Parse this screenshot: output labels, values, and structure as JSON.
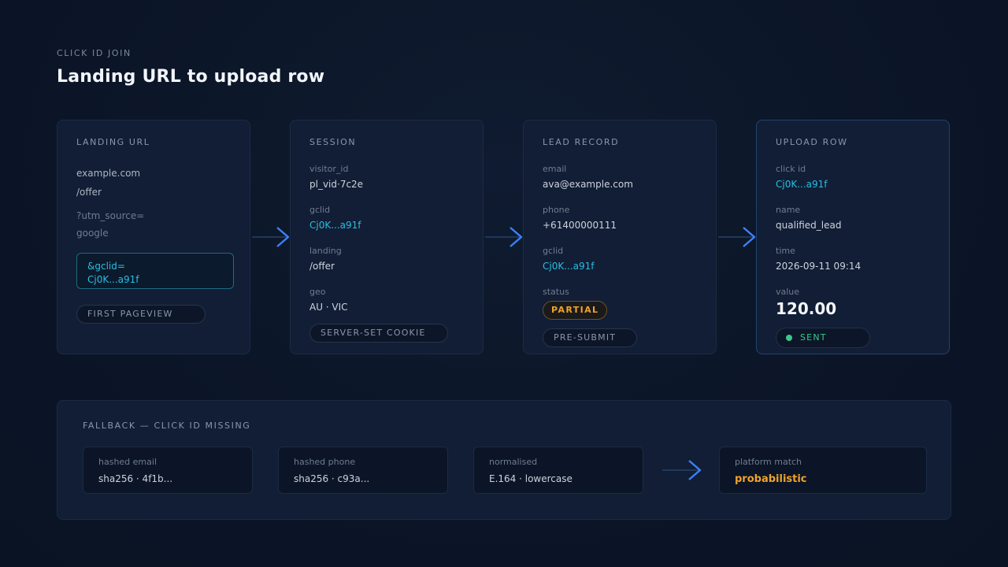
{
  "header": {
    "eyebrow": "CLICK ID JOIN",
    "title": "Landing URL to upload row"
  },
  "landing": {
    "heading": "LANDING URL",
    "domain": "example.com",
    "path": "/offer",
    "utm_key": "?utm_source=",
    "utm_value": "google",
    "gclid_param": "&gclid=",
    "gclid_value": "Cj0K...a91f",
    "badge": "FIRST PAGEVIEW"
  },
  "session": {
    "heading": "SESSION",
    "fields": [
      {
        "label": "visitor_id",
        "value": "pl_vid·7c2e"
      },
      {
        "label": "gclid",
        "value": "Cj0K...a91f"
      },
      {
        "label": "landing",
        "value": "/offer"
      },
      {
        "label": "geo",
        "value": "AU · VIC"
      }
    ],
    "badge": "SERVER-SET COOKIE"
  },
  "lead": {
    "heading": "LEAD RECORD",
    "fields": [
      {
        "label": "email",
        "value": "ava@example.com"
      },
      {
        "label": "phone",
        "value": "+61400000111"
      },
      {
        "label": "gclid",
        "value": "Cj0K...a91f"
      }
    ],
    "status_label": "status",
    "status_value": "PARTIAL",
    "badge": "PRE-SUBMIT"
  },
  "upload": {
    "heading": "UPLOAD ROW",
    "fields": [
      {
        "label": "click id",
        "value": "Cj0K...a91f"
      },
      {
        "label": "name",
        "value": "qualified_lead"
      },
      {
        "label": "time",
        "value": "2026-09-11 09:14"
      }
    ],
    "value_label": "value",
    "value": "120.00",
    "status": "SENT"
  },
  "fallback": {
    "heading": "FALLBACK — CLICK ID MISSING",
    "boxes": [
      {
        "label": "hashed email",
        "value": "sha256 · 4f1b..."
      },
      {
        "label": "hashed phone",
        "value": "sha256 · c93a..."
      },
      {
        "label": "normalised",
        "value": "E.164 · lowercase"
      },
      {
        "label": "platform match",
        "value": "probabilistic"
      }
    ]
  },
  "colors": {
    "accent_blue": "#3b82f6",
    "cyan": "#2bbde0",
    "orange": "#f0a22a",
    "green": "#38c98a"
  }
}
